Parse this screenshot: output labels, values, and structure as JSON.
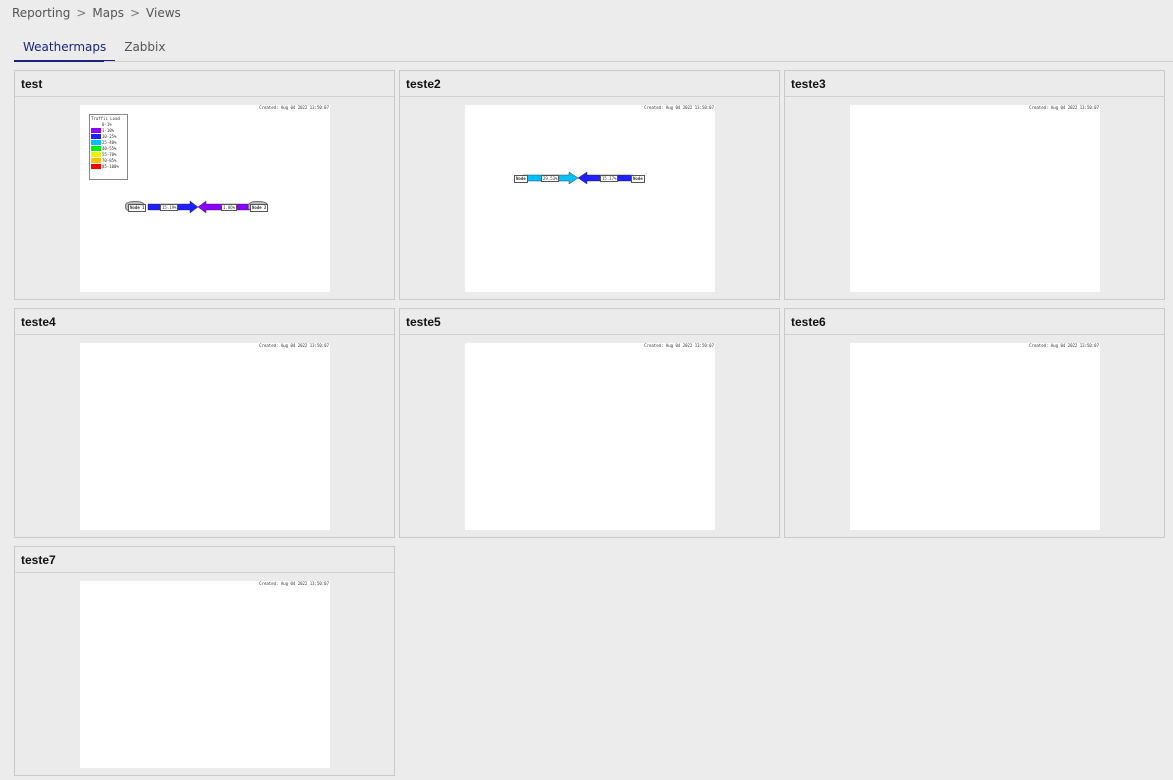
{
  "breadcrumb": {
    "items": [
      "Reporting",
      "Maps",
      "Views"
    ],
    "separator": ">"
  },
  "tabs": [
    {
      "label": "Weathermaps",
      "active": true
    },
    {
      "label": "Zabbix",
      "active": false
    }
  ],
  "created_text": "Created: Aug 04 2022 13:50:07",
  "legend": {
    "title": "Traffic Load",
    "rows": [
      {
        "label": "0-1%",
        "color": "#ffffff"
      },
      {
        "label": "1-10%",
        "color": "#8c00ff"
      },
      {
        "label": "10-25%",
        "color": "#2020ff"
      },
      {
        "label": "25-40%",
        "color": "#00c0ff"
      },
      {
        "label": "40-55%",
        "color": "#00f000"
      },
      {
        "label": "55-70%",
        "color": "#f0f000"
      },
      {
        "label": "70-85%",
        "color": "#ffc000"
      },
      {
        "label": "85-100%",
        "color": "#ff0000"
      }
    ]
  },
  "maps": [
    {
      "title": "test",
      "node_a": "Node 1",
      "node_b": "Node 2",
      "link_in": "15.19%",
      "link_out": "1.86%"
    },
    {
      "title": "teste2",
      "node_a": "Node",
      "node_b": "Node",
      "link_in": "29.53%",
      "link_out": "15.17%"
    },
    {
      "title": "teste3"
    },
    {
      "title": "teste4"
    },
    {
      "title": "teste5"
    },
    {
      "title": "teste6"
    },
    {
      "title": "teste7"
    }
  ],
  "colors": {
    "active_tab": "#1a237e",
    "background": "#ececec",
    "arrow_blue": "#2020ff",
    "arrow_purple": "#8c00ff",
    "arrow_cyan": "#00c0ff"
  }
}
